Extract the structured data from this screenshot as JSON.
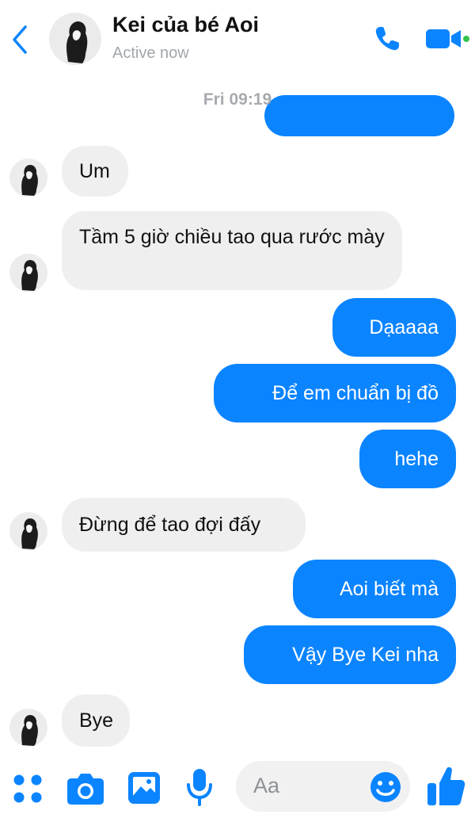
{
  "header": {
    "contact_name": "Kei của bé Aoi",
    "status": "Active now"
  },
  "chat": {
    "timestamp": "Fri 09:19",
    "messages": [
      {
        "from": "them",
        "text": "Um"
      },
      {
        "from": "them",
        "text": "Tầm 5 giờ chiều tao qua rước mày"
      },
      {
        "from": "me",
        "text": "Dạaaaa"
      },
      {
        "from": "me",
        "text": "Để em chuẩn bị đồ"
      },
      {
        "from": "me",
        "text": "hehe"
      },
      {
        "from": "them",
        "text": "Đừng để tao đợi đấy"
      },
      {
        "from": "me",
        "text": "Aoi biết mà"
      },
      {
        "from": "me",
        "text": "Vậy Bye Kei nha"
      },
      {
        "from": "them",
        "text": "Bye"
      }
    ]
  },
  "composer": {
    "placeholder": "Aa",
    "icons": [
      "menu-dots-icon",
      "camera-icon",
      "image-icon",
      "microphone-icon",
      "emoji-icon",
      "thumbs-up-icon"
    ]
  },
  "colors": {
    "accent": "#0B84FF",
    "incoming_bubble": "#EFEFEF",
    "status_gray": "#A2A6AB"
  }
}
